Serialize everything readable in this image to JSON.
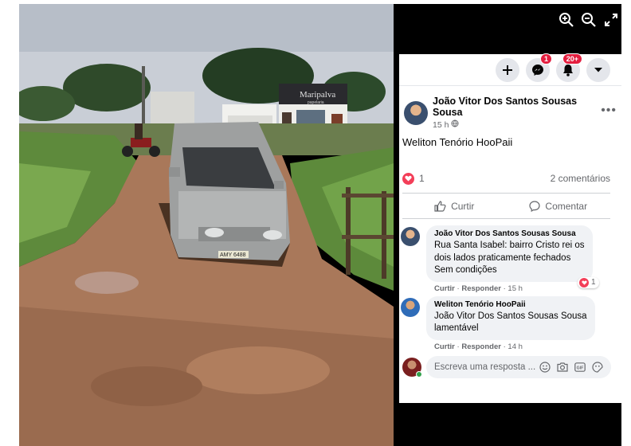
{
  "viewer": {
    "photo": {
      "shop_sign": "Maripalva",
      "shop_sign_sub": "papelaria",
      "plate": "AMY 6488"
    },
    "controls": [
      "zoom-in-icon",
      "zoom-out-icon",
      "fullscreen-icon"
    ]
  },
  "topbar": {
    "messenger_badge": "1",
    "notifications_badge": "20+"
  },
  "post": {
    "author": "João Vitor Dos Santos Sousas Sousa",
    "time": "15 h",
    "text": "Weliton Tenório HooPaii",
    "reaction_count": "1",
    "comment_count": "2 comentários",
    "like_label": "Curtir",
    "comment_label": "Comentar"
  },
  "comments": [
    {
      "author": "João Vitor Dos Santos Sousas Sousa",
      "lines": [
        "Rua Santa Isabel: bairro Cristo rei os",
        "dois lados praticamente fechados",
        "Sem condições"
      ],
      "like": "Curtir",
      "reply": "Responder",
      "time": "15 h",
      "reactions": "1"
    },
    {
      "author": "Weliton Tenório HooPaii",
      "lines": [
        "João Vitor Dos Santos Sousas Sousa",
        "lamentável"
      ],
      "like": "Curtir",
      "reply": "Responder",
      "time": "14 h"
    }
  ],
  "reply_box": {
    "placeholder": "Escreva uma resposta ..."
  },
  "colors": {
    "heart": "#f33e58",
    "badge": "#e41e3f",
    "online": "#31a24c"
  }
}
